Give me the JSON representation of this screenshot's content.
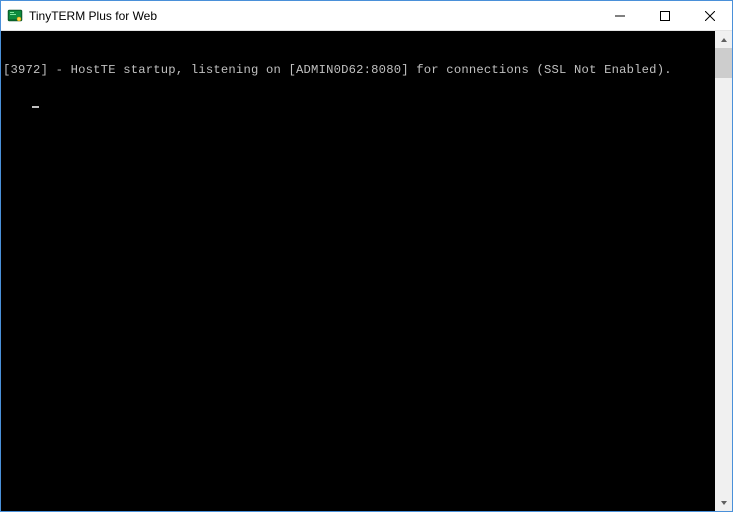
{
  "window": {
    "title": "TinyTERM Plus for Web"
  },
  "terminal": {
    "lines": [
      "[3972] - HostTE startup, listening on [ADMIN0D62:8080] for connections (SSL Not Enabled)."
    ]
  }
}
